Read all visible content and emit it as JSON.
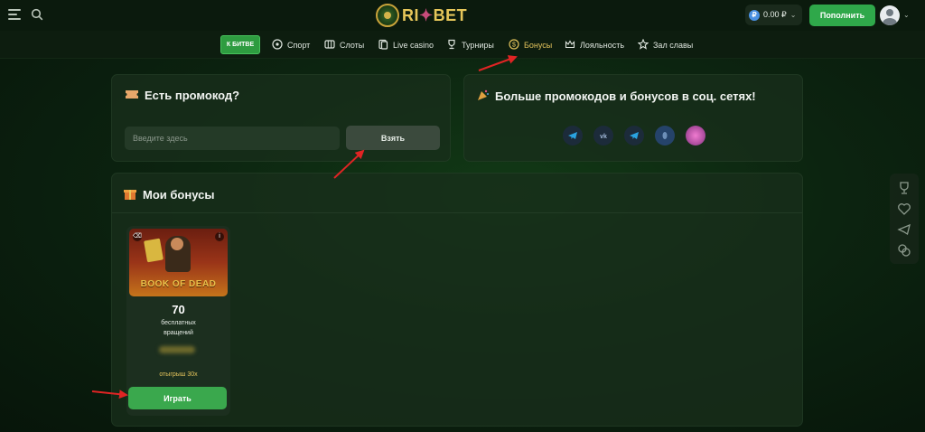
{
  "header": {
    "logo": {
      "left": "RI",
      "right": "BET"
    },
    "balance": {
      "amount": "0.00 ₽",
      "currency_symbol": "₽"
    },
    "deposit_label": "Пополнить"
  },
  "nav": {
    "battle_label": "К БИТВЕ",
    "items": [
      {
        "label": "Спорт",
        "icon": "soccer-ball-icon"
      },
      {
        "label": "Слоты",
        "icon": "slots-icon"
      },
      {
        "label": "Live casino",
        "icon": "cards-icon"
      },
      {
        "label": "Турниры",
        "icon": "trophy-icon"
      },
      {
        "label": "Бонусы",
        "icon": "coin-icon",
        "active": true
      },
      {
        "label": "Лояльность",
        "icon": "crown-icon"
      },
      {
        "label": "Зал славы",
        "icon": "star-icon"
      }
    ]
  },
  "promo": {
    "title": "Есть промокод?",
    "input_placeholder": "Введите здесь",
    "input_value": "",
    "button_label": "Взять"
  },
  "social": {
    "title": "Больше промокодов и бонусов в соц. сетях!",
    "links": [
      "telegram-icon",
      "vk-icon",
      "telegram-chat-icon",
      "blue-social-icon",
      "pink-social-icon"
    ]
  },
  "bonuses": {
    "title": "Мои бонусы",
    "cards": [
      {
        "game_title": "BOOK OF DEAD",
        "spins_count": "70",
        "spins_label_line1": "бесплатных",
        "spins_label_line2": "вращений",
        "wager": "отыгрыш 30x",
        "play_label": "Играть"
      }
    ]
  },
  "colors": {
    "accent_green": "#2fa84a",
    "gold": "#e3c35b",
    "annotation_red": "#e02424"
  }
}
